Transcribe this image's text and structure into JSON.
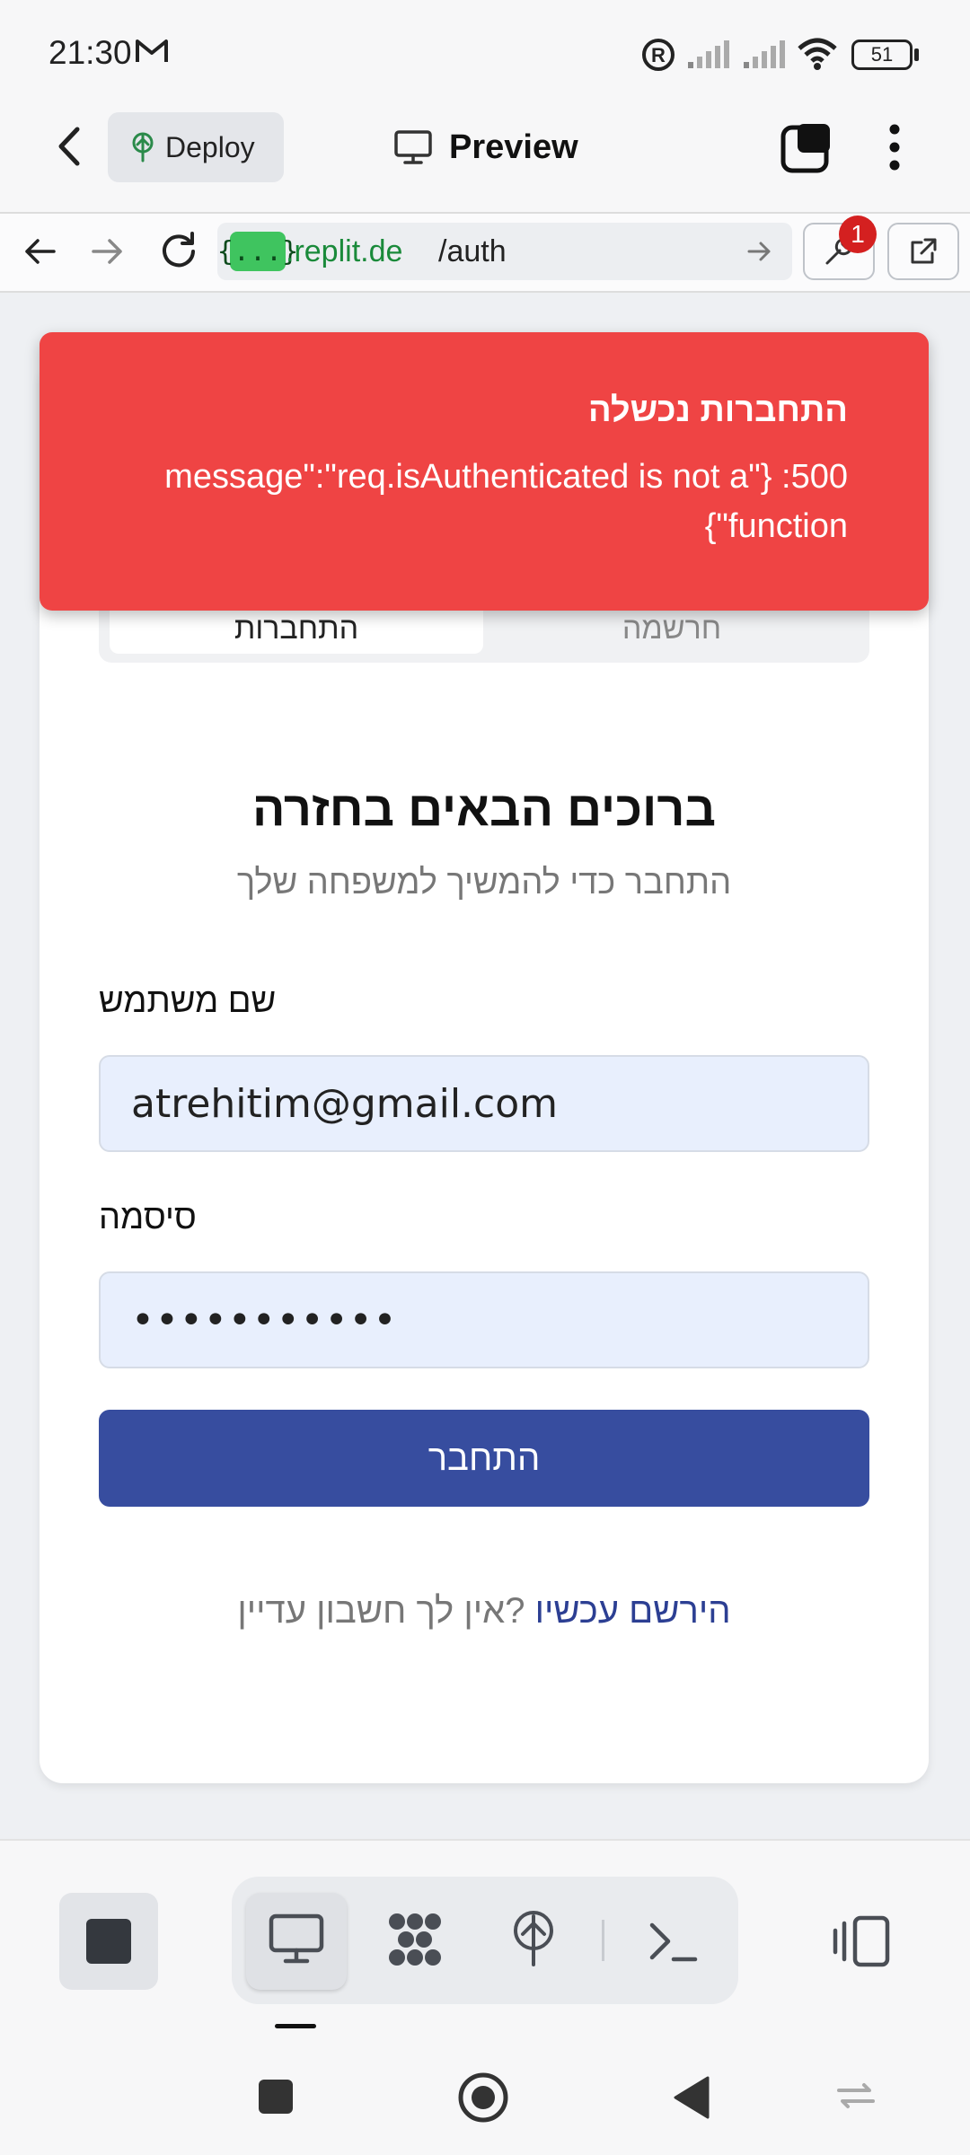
{
  "status_bar": {
    "time": "21:30",
    "battery": "51",
    "icons": [
      "gmail-icon",
      "registered-icon",
      "signal-icon",
      "signal-icon",
      "wifi-icon",
      "battery-icon"
    ]
  },
  "app_bar": {
    "deploy_label": "Deploy",
    "preview_label": "Preview"
  },
  "url_bar": {
    "host_badge": "{...}",
    "host": ".replit.de",
    "path": "/auth",
    "notification_count": "1"
  },
  "toast": {
    "title": "התחברות נכשלה",
    "message_line1": "message\":\"req.isAuthenticated is not a\"} :500",
    "message_line2": "{\"function"
  },
  "auth": {
    "tab_login": "התחברות",
    "tab_register": "חרשמה",
    "heading": "ברוכים הבאים בחזרה",
    "subheading": "התחבר כדי להמשיך למשפחה שלך",
    "username_label": "שם משתמש",
    "username_value": "atrehitim@gmail.com",
    "password_label": "סיסמה",
    "password_value": "•••••••••••",
    "login_button": "התחבר",
    "signup_link": "הירשם עכשיו",
    "signup_text": "?אין לך חשבון עדיין"
  },
  "colors": {
    "toast_bg": "#ef4444",
    "primary": "#374d9f",
    "input_bg": "#e8effd",
    "url_host": "#1a8a3a"
  }
}
